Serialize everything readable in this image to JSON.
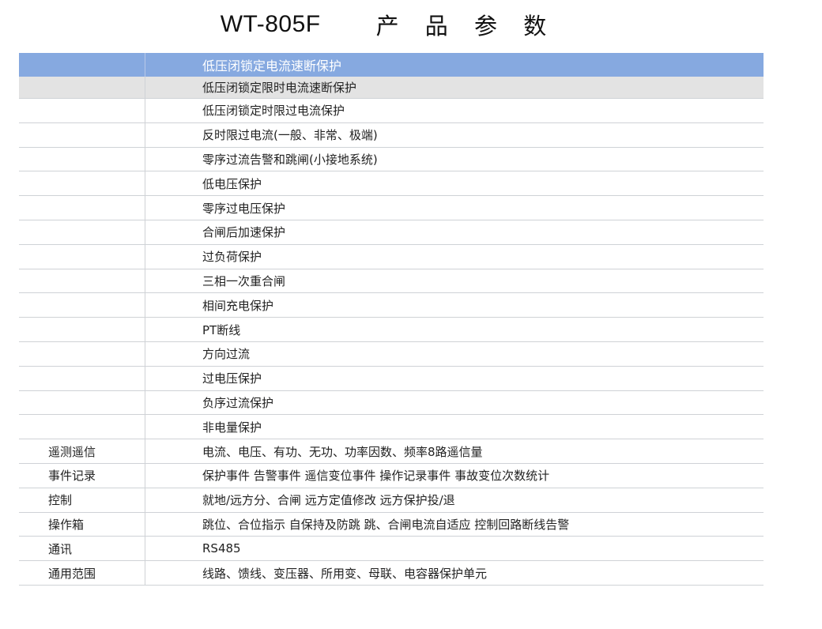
{
  "title": {
    "model": "WT-805F",
    "heading": "产 品 参 数"
  },
  "header_row": {
    "label": "",
    "value": "低压闭锁定电流速断保护"
  },
  "rows": [
    {
      "label": "",
      "value": "低压闭锁定限时电流速断保护"
    },
    {
      "label": "",
      "value": "低压闭锁定时限过电流保护"
    },
    {
      "label": "",
      "value": "反时限过电流(一般、非常、极端)"
    },
    {
      "label": "",
      "value": "零序过流告警和跳闸(小接地系统)"
    },
    {
      "label": "",
      "value": "低电压保护"
    },
    {
      "label": "",
      "value": "零序过电压保护"
    },
    {
      "label": "",
      "value": "合闸后加速保护"
    },
    {
      "label": "",
      "value": "过负荷保护"
    },
    {
      "label": "",
      "value": "三相一次重合闸"
    },
    {
      "label": "",
      "value": "相间充电保护"
    },
    {
      "label": "",
      "value": "PT断线"
    },
    {
      "label": "",
      "value": "方向过流"
    },
    {
      "label": "",
      "value": "过电压保护"
    },
    {
      "label": "",
      "value": "负序过流保护"
    },
    {
      "label": "",
      "value": "非电量保护"
    },
    {
      "label": "遥测遥信",
      "value": "电流、电压、有功、无功、功率因数、频率8路遥信量"
    },
    {
      "label": "事件记录",
      "value": "保护事件  告警事件  遥信变位事件  操作记录事件  事故变位次数统计"
    },
    {
      "label": "控制",
      "value": "就地/远方分、合闸  远方定值修改  远方保护投/退"
    },
    {
      "label": "操作箱",
      "value": "跳位、合位指示  自保持及防跳  跳、合闸电流自适应  控制回路断线告警"
    },
    {
      "label": "通讯",
      "value": "RS485"
    },
    {
      "label": "通用范围",
      "value": "线路、馈线、变压器、所用变、母联、电容器保护单元"
    }
  ],
  "colors": {
    "header_bg": "#86a9e0",
    "shaded_bg": "#e3e3e3",
    "divider": "#cfd2d6"
  }
}
